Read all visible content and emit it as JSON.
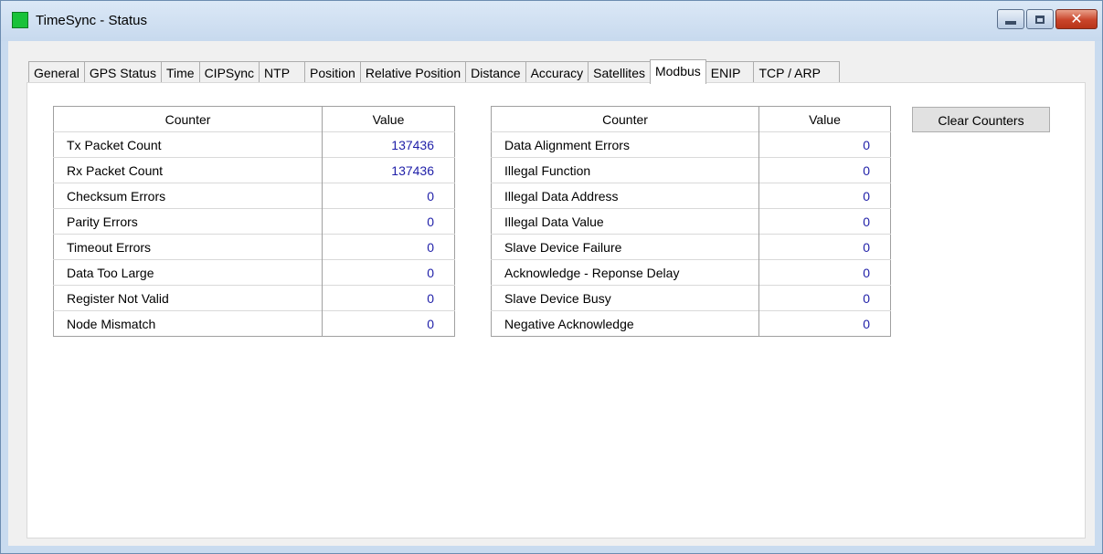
{
  "window": {
    "title": "TimeSync - Status"
  },
  "tabs": [
    {
      "label": "General"
    },
    {
      "label": "GPS Status"
    },
    {
      "label": "Time"
    },
    {
      "label": "CIPSync"
    },
    {
      "label": "NTP"
    },
    {
      "label": "Position"
    },
    {
      "label": "Relative Position"
    },
    {
      "label": "Distance"
    },
    {
      "label": "Accuracy"
    },
    {
      "label": "Satellites"
    },
    {
      "label": "Modbus",
      "active": true
    },
    {
      "label": "ENIP"
    },
    {
      "label": "TCP / ARP"
    }
  ],
  "left_table": {
    "header_counter": "Counter",
    "header_value": "Value",
    "rows": [
      {
        "counter": "Tx Packet Count",
        "value": "137436"
      },
      {
        "counter": "Rx Packet Count",
        "value": "137436"
      },
      {
        "counter": "Checksum Errors",
        "value": "0"
      },
      {
        "counter": "Parity Errors",
        "value": "0"
      },
      {
        "counter": "Timeout Errors",
        "value": "0"
      },
      {
        "counter": "Data Too Large",
        "value": "0"
      },
      {
        "counter": "Register Not Valid",
        "value": "0"
      },
      {
        "counter": "Node Mismatch",
        "value": "0"
      }
    ]
  },
  "right_table": {
    "header_counter": "Counter",
    "header_value": "Value",
    "rows": [
      {
        "counter": "Data Alignment Errors",
        "value": "0"
      },
      {
        "counter": "Illegal Function",
        "value": "0"
      },
      {
        "counter": "Illegal Data Address",
        "value": "0"
      },
      {
        "counter": "Illegal Data Value",
        "value": "0"
      },
      {
        "counter": "Slave Device Failure",
        "value": "0"
      },
      {
        "counter": "Acknowledge - Reponse Delay",
        "value": "0"
      },
      {
        "counter": "Slave Device Busy",
        "value": "0"
      },
      {
        "counter": "Negative Acknowledge",
        "value": "0"
      }
    ]
  },
  "clear_button": {
    "label": "Clear Counters"
  },
  "colors": {
    "value_text": "#1f1fa8",
    "app_icon": "#19c23a",
    "close_button": "#c9442a"
  },
  "icons": {
    "app": "green-square-icon",
    "minimize": "minimize-icon",
    "maximize": "maximize-icon",
    "close": "close-icon"
  }
}
